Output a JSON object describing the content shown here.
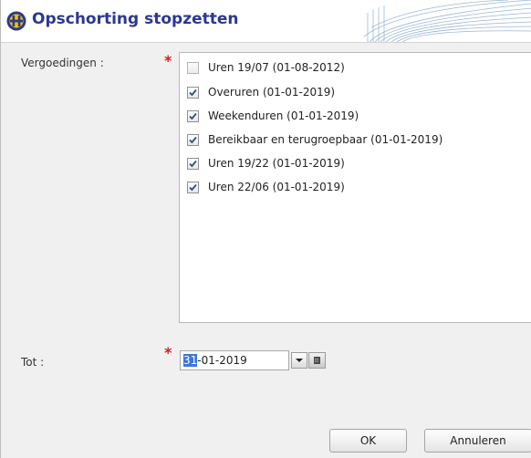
{
  "dialog": {
    "title": "Opschorting stopzetten"
  },
  "fields": {
    "allowances_label": "Vergoedingen :",
    "until_label": "Tot :",
    "required_mark": "*"
  },
  "allowances": [
    {
      "label": "Uren 19/07 (01-08-2012)",
      "checked": false
    },
    {
      "label": "Overuren (01-01-2019)",
      "checked": true
    },
    {
      "label": "Weekenduren (01-01-2019)",
      "checked": true
    },
    {
      "label": "Bereikbaar en terugroepbaar (01-01-2019)",
      "checked": true
    },
    {
      "label": "Uren 19/22 (01-01-2019)",
      "checked": true
    },
    {
      "label": "Uren 22/06 (01-01-2019)",
      "checked": true
    }
  ],
  "date": {
    "selected_part": "31",
    "rest": "-01-2019"
  },
  "buttons": {
    "ok": "OK",
    "cancel": "Annuleren"
  },
  "icons": {
    "logo": "company-logo-icon",
    "dropdown": "chevron-down-icon",
    "calendar": "calendar-icon"
  },
  "colors": {
    "title": "#2b3990",
    "required": "#e0161f",
    "selection": "#3b78d8"
  }
}
